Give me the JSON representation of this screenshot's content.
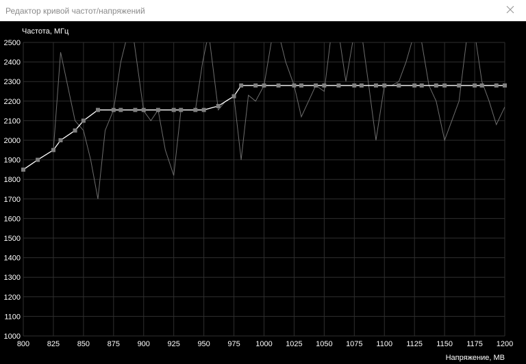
{
  "window": {
    "title": "Редактор кривой частот/напряжений",
    "close_icon": "close-icon"
  },
  "colors": {
    "background": "#000000",
    "grid": "#2f2f2f",
    "curve": "#ffffff",
    "points": "#808080",
    "raw": "#6e6e6e",
    "text": "#ffffff"
  },
  "chart_data": {
    "type": "line",
    "title": "",
    "xlabel": "Напряжение, МВ",
    "ylabel": "Частота, МГц",
    "xlim": [
      800,
      1200
    ],
    "ylim": [
      1000,
      2500
    ],
    "xticks": [
      800,
      825,
      850,
      875,
      900,
      925,
      950,
      975,
      1000,
      1025,
      1050,
      1075,
      1100,
      1125,
      1150,
      1175,
      1200
    ],
    "yticks": [
      1000,
      1100,
      1200,
      1300,
      1400,
      1500,
      1600,
      1700,
      1800,
      1900,
      2000,
      2100,
      2200,
      2300,
      2400,
      2500
    ],
    "grid": true,
    "series": [
      {
        "role": "curve",
        "x": [
          800,
          812,
          825,
          831,
          843,
          850,
          862,
          875,
          881,
          893,
          900,
          912,
          925,
          931,
          943,
          950,
          962,
          975,
          981,
          993,
          1000,
          1012,
          1025,
          1031,
          1043,
          1050,
          1062,
          1075,
          1081,
          1093,
          1100,
          1112,
          1125,
          1131,
          1143,
          1150,
          1162,
          1175,
          1181,
          1193,
          1200
        ],
        "y": [
          1850,
          1900,
          1950,
          2000,
          2050,
          2100,
          2155,
          2155,
          2155,
          2155,
          2155,
          2155,
          2155,
          2155,
          2155,
          2155,
          2175,
          2225,
          2280,
          2280,
          2280,
          2280,
          2280,
          2280,
          2280,
          2280,
          2280,
          2280,
          2280,
          2280,
          2280,
          2280,
          2280,
          2280,
          2280,
          2280,
          2280,
          2280,
          2280,
          2280,
          2280
        ]
      },
      {
        "role": "raw",
        "x": [
          800,
          812,
          825,
          831,
          843,
          850,
          856,
          862,
          868,
          875,
          881,
          887,
          891,
          900,
          906,
          912,
          918,
          925,
          931,
          937,
          943,
          949,
          954,
          962,
          968,
          975,
          981,
          987,
          993,
          1000,
          1006,
          1012,
          1018,
          1025,
          1031,
          1037,
          1043,
          1050,
          1056,
          1062,
          1068,
          1075,
          1081,
          1087,
          1093,
          1100,
          1106,
          1112,
          1118,
          1125,
          1131,
          1137,
          1143,
          1150,
          1156,
          1162,
          1168,
          1175,
          1181,
          1187,
          1193,
          1200
        ],
        "y": [
          1850,
          1900,
          1950,
          2450,
          2100,
          2050,
          1900,
          1700,
          2050,
          2155,
          2400,
          2550,
          2550,
          2150,
          2100,
          2155,
          1950,
          1820,
          2155,
          2155,
          2155,
          2400,
          2550,
          2155,
          2200,
          2225,
          1900,
          2230,
          2200,
          2280,
          2500,
          2550,
          2400,
          2280,
          2120,
          2200,
          2280,
          2250,
          2550,
          2550,
          2300,
          2550,
          2550,
          2280,
          2000,
          2280,
          2280,
          2300,
          2400,
          2550,
          2500,
          2280,
          2200,
          2000,
          2100,
          2200,
          2500,
          2550,
          2300,
          2200,
          2080,
          2170
        ]
      }
    ]
  }
}
